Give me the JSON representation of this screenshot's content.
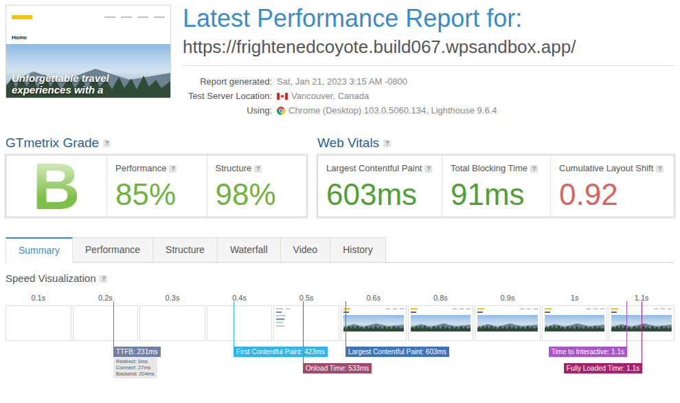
{
  "thumbnail": {
    "page_title": "Home",
    "hero_text": "Unforgettable travel experiences with a"
  },
  "header": {
    "title": "Latest Performance Report for:",
    "url": "https://frightenedcoyote.build067.wpsandbox.app/"
  },
  "meta": [
    {
      "label": "Report generated:",
      "value": "Sat, Jan 21, 2023 3:15 AM -0800",
      "kind": "text"
    },
    {
      "label": "Test Server Location:",
      "value": "Vancouver, Canada",
      "kind": "flag"
    },
    {
      "label": "Using:",
      "value": "Chrome (Desktop) 103.0.5060.134, Lighthouse 9.6.4",
      "kind": "browser"
    }
  ],
  "grade": {
    "title": "GTmetrix Grade",
    "help": "?",
    "letter": "B",
    "color": "#7dbf48",
    "scores": [
      {
        "label": "Performance",
        "help": "?",
        "value": "85%",
        "color": "#6fb33e"
      },
      {
        "label": "Structure",
        "help": "?",
        "value": "98%",
        "color": "#6fb33e"
      }
    ]
  },
  "web_vitals": {
    "title": "Web Vitals",
    "help": "?",
    "metrics": [
      {
        "label": "Largest Contentful Paint",
        "help": "?",
        "value": "603ms",
        "color": "#4f9f36"
      },
      {
        "label": "Total Blocking Time",
        "help": "?",
        "value": "91ms",
        "color": "#4f9f36"
      },
      {
        "label": "Cumulative Layout Shift",
        "help": "?",
        "value": "0.92",
        "color": "#d9635f"
      }
    ]
  },
  "tabs": [
    {
      "label": "Summary",
      "selected": true
    },
    {
      "label": "Performance",
      "selected": false
    },
    {
      "label": "Structure",
      "selected": false
    },
    {
      "label": "Waterfall",
      "selected": false
    },
    {
      "label": "Video",
      "selected": false
    },
    {
      "label": "History",
      "selected": false
    }
  ],
  "speed_visualization": {
    "title": "Speed Visualization",
    "help": "?",
    "ticks": [
      "0.1s",
      "0.2s",
      "0.3s",
      "0.4s",
      "0.5s",
      "0.6s",
      "0.8s",
      "0.9s",
      "1s",
      "1.1s"
    ],
    "frames": [
      {
        "kind": "blank"
      },
      {
        "kind": "blank"
      },
      {
        "kind": "blank"
      },
      {
        "kind": "blank"
      },
      {
        "kind": "partial"
      },
      {
        "kind": "rendered"
      },
      {
        "kind": "rendered"
      },
      {
        "kind": "rendered"
      },
      {
        "kind": "rendered"
      },
      {
        "kind": "rendered"
      }
    ],
    "markers": [
      {
        "label": "TTFB: 231ms",
        "color": "#6e80a8",
        "details": [
          "Redirect: 0ms",
          "Connect: 27ms",
          "Backend: 204ms"
        ]
      },
      {
        "label": "First Contentful Paint: 423ms",
        "color": "#2fb3e8",
        "details": []
      },
      {
        "label": "Onload Time: 533ms",
        "color": "#a04a6c",
        "details": []
      },
      {
        "label": "Largest Contentful Paint: 603ms",
        "color": "#3f72b8",
        "details": []
      },
      {
        "label": "Time to Interactive: 1.1s",
        "color": "#a855c8",
        "details": []
      },
      {
        "label": "Fully Loaded Time: 1.1s",
        "color": "#a3226a",
        "details": []
      }
    ]
  }
}
